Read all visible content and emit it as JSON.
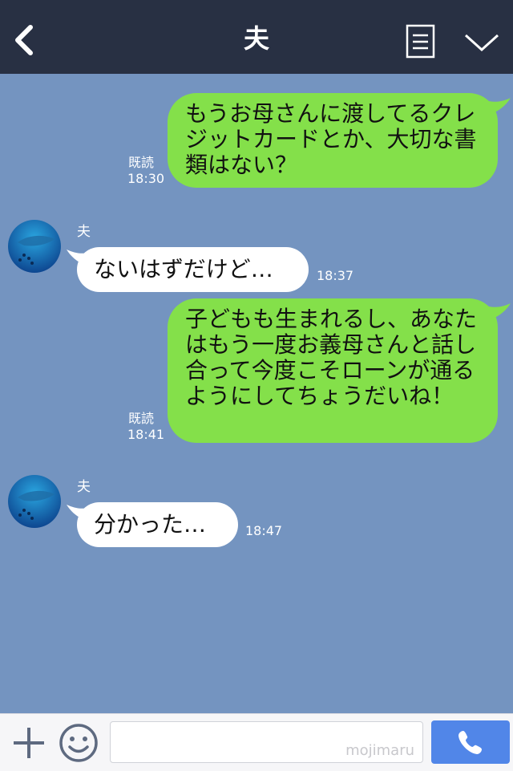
{
  "header": {
    "title": "夫"
  },
  "messages": [
    {
      "side": "right",
      "text": "もうお母さんに渡してるクレジットカードとか、大切な書類はない？",
      "status": "既読",
      "time": "18:30"
    },
    {
      "side": "left",
      "sender": "夫",
      "text": "ないはずだけど…",
      "time": "18:37"
    },
    {
      "side": "right",
      "text": "子どもも生まれるし、あなたはもう一度お義母さんと話し合って今度こそローンが通るようにしてちょうだいね！",
      "status": "既読",
      "time": "18:41"
    },
    {
      "side": "left",
      "sender": "夫",
      "text": "分かった…",
      "time": "18:47"
    }
  ],
  "input": {
    "placeholder": "",
    "watermark": "mojimaru"
  },
  "colors": {
    "background": "#7494c0",
    "header": "#283043",
    "outgoing_bubble": "#84e04a",
    "incoming_bubble": "#ffffff",
    "call_button": "#5186e8"
  },
  "icons": {
    "back": "chevron-left-icon",
    "menu": "note-list-icon",
    "expand": "chevron-down-icon",
    "add": "plus-icon",
    "sticker": "smiley-icon",
    "call": "phone-icon"
  }
}
